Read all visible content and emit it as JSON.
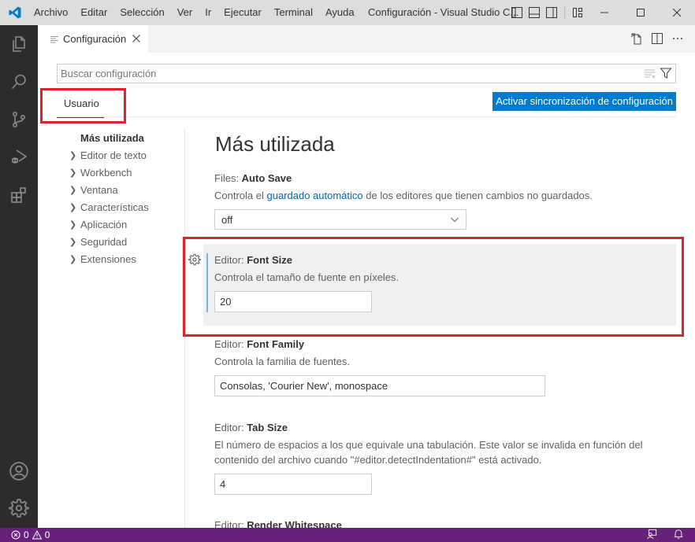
{
  "titlebar": {
    "menu": [
      "Archivo",
      "Editar",
      "Selección",
      "Ver",
      "Ir",
      "Ejecutar",
      "Terminal",
      "Ayuda"
    ],
    "window_title": "Configuración - Visual Studio C...",
    "brand_color": "#007acc"
  },
  "activity_bar": {
    "icons": [
      "explorer-icon",
      "search-icon",
      "source-control-icon",
      "run-debug-icon",
      "extensions-icon",
      "accounts-icon",
      "manage-gear-icon"
    ]
  },
  "tabs": [
    {
      "label": "Configuración",
      "icon": "settings-file-icon",
      "active": true
    }
  ],
  "settings_editor": {
    "search": {
      "placeholder": "Buscar configuración",
      "value": ""
    },
    "scope_tabs": [
      {
        "label": "Usuario",
        "active": true
      }
    ],
    "sync_button_label": "Activar sincronización de configuración",
    "toc": [
      {
        "label": "Más utilizada",
        "active": true,
        "expandable": false
      },
      {
        "label": "Editor de texto",
        "active": false,
        "expandable": true
      },
      {
        "label": "Workbench",
        "active": false,
        "expandable": true
      },
      {
        "label": "Ventana",
        "active": false,
        "expandable": true
      },
      {
        "label": "Características",
        "active": false,
        "expandable": true
      },
      {
        "label": "Aplicación",
        "active": false,
        "expandable": true
      },
      {
        "label": "Seguridad",
        "active": false,
        "expandable": true
      },
      {
        "label": "Extensiones",
        "active": false,
        "expandable": true
      }
    ],
    "section_title": "Más utilizada",
    "settings": [
      {
        "category": "Files: ",
        "name": "Auto Save",
        "desc_pre": "Controla el ",
        "desc_link": "guardado automático",
        "desc_post": " de los editores que tienen cambios no guardados.",
        "type": "select",
        "value": "off"
      },
      {
        "category": "Editor: ",
        "name": "Font Size",
        "desc": "Controla el tamaño de fuente en píxeles.",
        "type": "number",
        "value": "20",
        "focused": true
      },
      {
        "category": "Editor: ",
        "name": "Font Family",
        "desc": "Controla la familia de fuentes.",
        "type": "text",
        "value": "Consolas, 'Courier New', monospace"
      },
      {
        "category": "Editor: ",
        "name": "Tab Size",
        "desc": "El número de espacios a los que equivale una tabulación. Este valor se invalida en función del contenido del archivo cuando \"#editor.detectIndentation#\" está activado.",
        "type": "number",
        "value": "4"
      },
      {
        "category": "Editor: ",
        "name": "Render Whitespace"
      }
    ]
  },
  "statusbar": {
    "errors": "0",
    "warnings": "0",
    "color": "#68217a"
  },
  "annotations": {
    "highlight_color": "#e3202a"
  }
}
